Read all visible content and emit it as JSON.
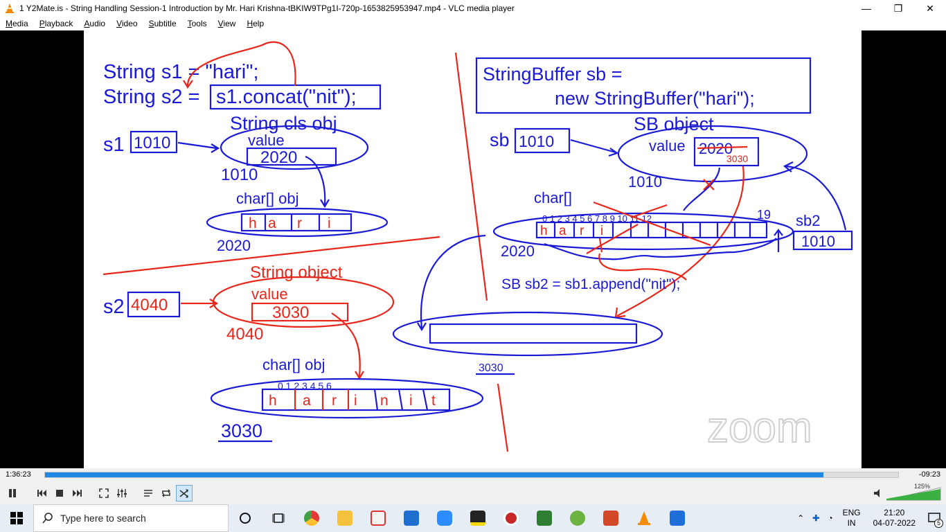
{
  "window": {
    "title": "1 Y2Mate.is - String Handling Session-1 Introduction  by Mr. Hari Krishna-tBKIW9TPg1I-720p-1653825953947.mp4 - VLC media player",
    "minimize": "—",
    "maximize": "❐",
    "close": "✕"
  },
  "menu": [
    "Media",
    "Playback",
    "Audio",
    "Video",
    "Subtitle",
    "Tools",
    "View",
    "Help"
  ],
  "board": {
    "left": {
      "line1": "String s1 = \"hari\";",
      "line2a": "String s2 =",
      "line2b": "s1.concat(\"nit\");",
      "cls_obj": "String cls obj",
      "s1": "s1",
      "s1_ref": "1010",
      "value1": "value",
      "val_2020": "2020",
      "addr_1010": "1010",
      "charobj1": "char[] obj",
      "hari_chars": [
        "h",
        "a",
        "r",
        "i"
      ],
      "addr_2020": "2020",
      "string_object": "String object",
      "s2": "s2",
      "s2_ref": "4040",
      "value2": "value",
      "val_3030": "3030",
      "addr_4040": "4040",
      "charobj2": "char[] obj",
      "harinit_chars": [
        "h",
        "a",
        "r",
        "i",
        "n",
        "i",
        "t"
      ],
      "index_marks": "0  1  2  3  4  5  6",
      "addr_3030": "3030"
    },
    "right": {
      "sb_line1": "StringBuffer sb =",
      "sb_line2": "new StringBuffer(\"hari\");",
      "sb_object": "SB object",
      "sb": "sb",
      "sb_ref": "1010",
      "value": "value",
      "val_2020": "2020",
      "val_3030": "3030",
      "addr_1010": "1010",
      "char_label": "char[]",
      "sb_chars": [
        "h",
        "a",
        "r",
        "i"
      ],
      "index_marks": "0 1 2 3 4 5 6 7 8 9 10 11 12",
      "idx_19": "19",
      "addr_2020": "2020",
      "sb2": "sb2",
      "sb2_ref": "1010",
      "append": "SB sb2 = sb1.append(\"nit\");",
      "addr_3030": "3030"
    },
    "watermark": "zoom"
  },
  "player": {
    "elapsed": "1:36:23",
    "remaining": "-09:23",
    "progress_fraction": 0.9126,
    "volume": "125%"
  },
  "taskbar": {
    "search_placeholder": "Type here to search",
    "lang_top": "ENG",
    "lang_bottom": "IN",
    "time": "21:20",
    "date": "04-07-2022",
    "notif_count": "5"
  },
  "colors": {
    "ink_blue": "#1a1ad6",
    "ink_red": "#e8261a",
    "seek_blue": "#1e88e5",
    "taskbar": "#e6edf5"
  }
}
